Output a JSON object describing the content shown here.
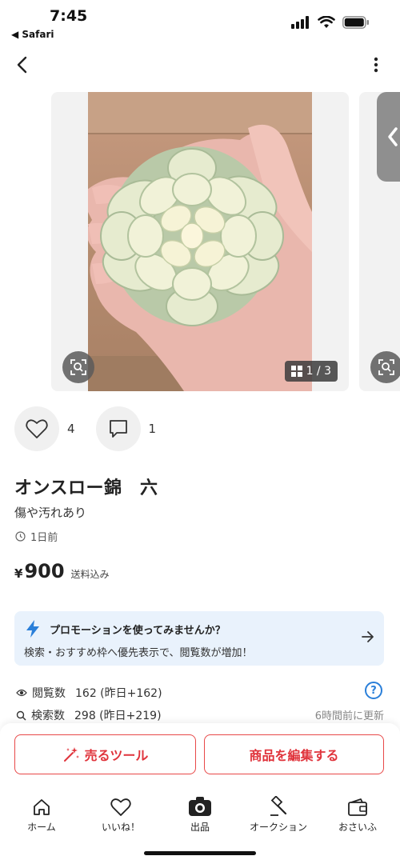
{
  "status_bar": {
    "time": "7:45",
    "back_app": "◀ Safari"
  },
  "carousel": {
    "counter": "1 / 3"
  },
  "reactions": {
    "likes": "4",
    "comments": "1"
  },
  "item": {
    "title": "オンスロー錦　六",
    "condition": "傷や汚れあり",
    "posted": "1日前",
    "price_symbol": "¥",
    "price": "900",
    "shipping": "送料込み"
  },
  "promo": {
    "title": "プロモーションを使ってみませんか？",
    "text": "検索・おすすめ枠へ優先表示で、閲覧数が増加！"
  },
  "stats": {
    "views_label": "閲覧数",
    "views_value": "162 (昨日+162)",
    "searches_label": "検索数",
    "searches_value": "298 (昨日+219)",
    "updated": "6時間前に更新"
  },
  "actions": {
    "sell_tool": "売るツール",
    "edit_item": "商品を編集する"
  },
  "tabs": [
    {
      "label": "ホーム",
      "icon": "home-icon"
    },
    {
      "label": "いいね！",
      "icon": "heart-icon"
    },
    {
      "label": "出品",
      "icon": "camera-icon"
    },
    {
      "label": "オークション",
      "icon": "gavel-icon"
    },
    {
      "label": "おさいふ",
      "icon": "wallet-icon"
    }
  ],
  "colors": {
    "accent_red": "#e0343c",
    "promo_bg": "#e9f2fc",
    "promo_icon": "#2a7fd9"
  }
}
